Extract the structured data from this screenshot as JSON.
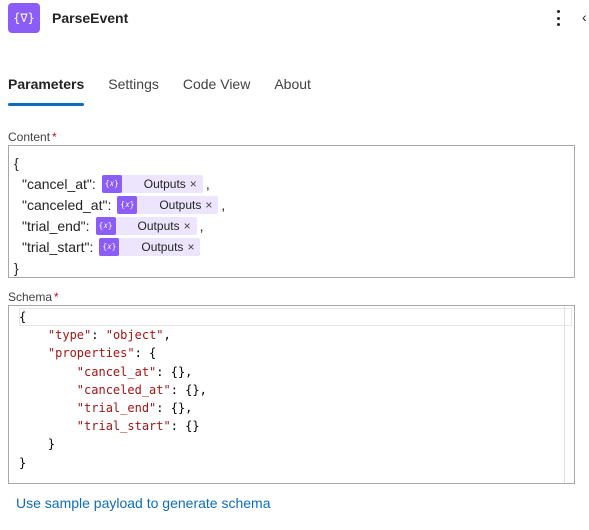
{
  "header": {
    "icon_glyph": "{∇}",
    "title": "ParseEvent",
    "more_icon": "more-vertical-icon",
    "collapse_glyph": "‹"
  },
  "tabs": [
    {
      "label": "Parameters",
      "active": true
    },
    {
      "label": "Settings",
      "active": false
    },
    {
      "label": "Code View",
      "active": false
    },
    {
      "label": "About",
      "active": false
    }
  ],
  "content": {
    "label": "Content",
    "required_mark": "*",
    "open_brace": "{",
    "close_brace": "}",
    "rows": [
      {
        "key": "\"cancel_at\":",
        "token": "Outputs",
        "close": "×",
        "trail": ","
      },
      {
        "key": "\"canceled_at\":",
        "token": "Outputs",
        "close": "×",
        "trail": ","
      },
      {
        "key": "\"trial_end\":",
        "token": "Outputs",
        "close": "×",
        "trail": ","
      },
      {
        "key": "\"trial_start\":",
        "token": "Outputs",
        "close": "×",
        "trail": ""
      }
    ],
    "token_glyph": "{𝑥}"
  },
  "schema": {
    "label": "Schema",
    "required_mark": "*",
    "lines": [
      "{",
      "    \"type\": \"object\",",
      "    \"properties\": {",
      "        \"cancel_at\": {},",
      "        \"canceled_at\": {},",
      "        \"trial_end\": {},",
      "        \"trial_start\": {}",
      "    }",
      "}"
    ]
  },
  "link_text": "Use sample payload to generate schema",
  "colors": {
    "accent": "#0f6cbd",
    "token_icon": "#8b5cf6",
    "token_bg": "#ede5fd",
    "required": "#c50f1f"
  }
}
